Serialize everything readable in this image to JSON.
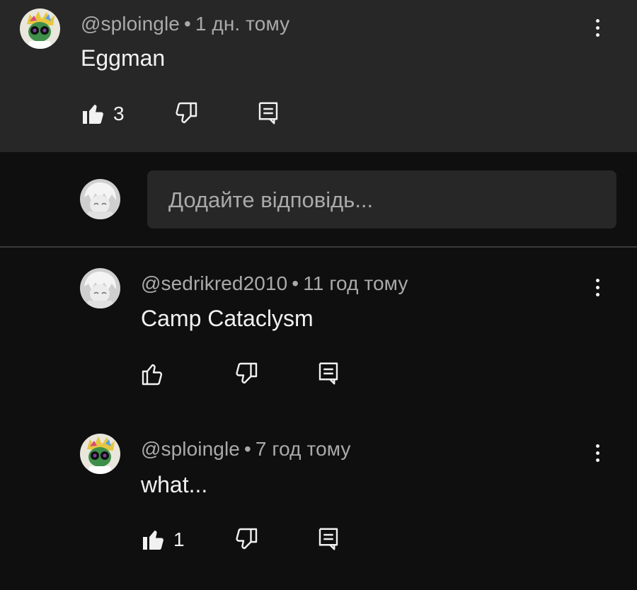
{
  "top_comment": {
    "author": "@sploingle",
    "separator": "•",
    "time": "1 дн. тому",
    "text": "Eggman",
    "likes": "3",
    "liked": true
  },
  "reply_input": {
    "placeholder": "Додайте відповідь..."
  },
  "replies": [
    {
      "author": "@sedrikred2010",
      "separator": "•",
      "time": "11 год тому",
      "text": "Camp Cataclysm",
      "likes": "",
      "liked": false
    },
    {
      "author": "@sploingle",
      "separator": "•",
      "time": "7 год тому",
      "text": "what...",
      "likes": "1",
      "liked": true
    }
  ],
  "icons": {
    "like": "thumbs-up-icon",
    "dislike": "thumbs-down-icon",
    "reply": "reply-icon",
    "menu": "more-vert-icon"
  },
  "colors": {
    "background": "#0f0f0f",
    "highlight_background": "#272727",
    "text": "#f1f1f1",
    "secondary_text": "#aaaaaa"
  }
}
